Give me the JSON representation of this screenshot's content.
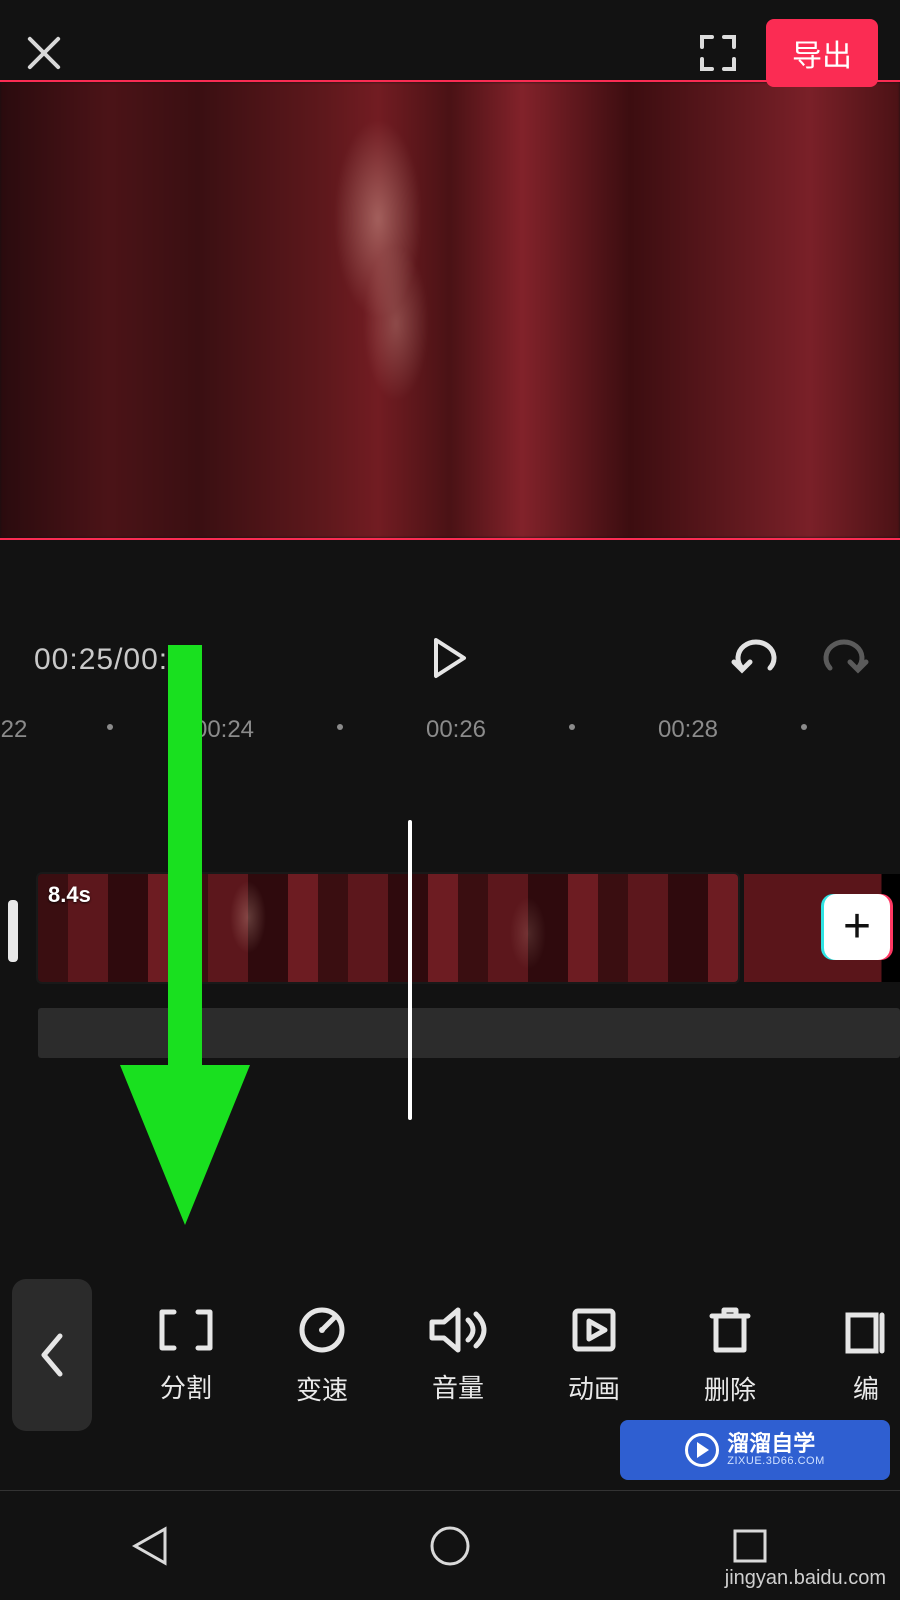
{
  "header": {
    "export_label": "导出"
  },
  "transport": {
    "timecode": "00:25/00:"
  },
  "ruler": {
    "ticks": [
      "22",
      "00:24",
      "00:26",
      "00:28"
    ]
  },
  "segment": {
    "duration_label": "8.4s"
  },
  "toolbar": {
    "items": [
      {
        "key": "split",
        "label": "分割"
      },
      {
        "key": "speed",
        "label": "变速"
      },
      {
        "key": "volume",
        "label": "音量"
      },
      {
        "key": "anim",
        "label": "动画"
      },
      {
        "key": "delete",
        "label": "删除"
      },
      {
        "key": "edit",
        "label": "编"
      }
    ]
  },
  "watermark": {
    "brand": "溜溜自学",
    "brand_sub": "ZIXUE.3D66.COM",
    "source": "jingyan.baidu.com"
  }
}
